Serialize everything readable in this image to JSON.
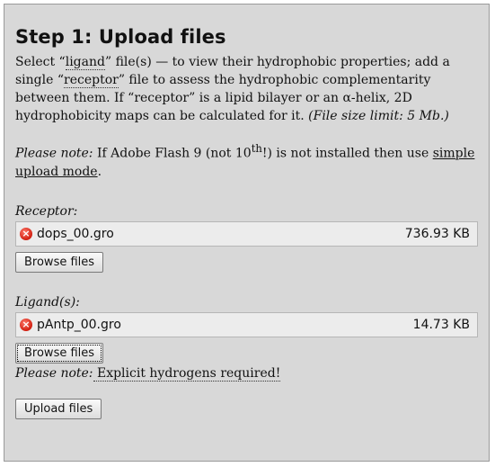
{
  "title": "Step 1: Upload files",
  "intro": {
    "t1": "Select “",
    "ligand_word": "ligand",
    "t2": "” file(s) — to view their hydrophobic properties; add a single “",
    "receptor_word": "receptor",
    "t3": "” file to assess the hydrophobic complementarity between them. If “receptor” is a lipid bilayer or an α-helix, 2D hydrophobicity maps can be calculated for it. ",
    "size_limit": "(File size limit: 5 Mb.)"
  },
  "flash_note": {
    "label": "Please note:",
    "t1": " If Adobe Flash 9 (not 10",
    "sup": "th",
    "t2": "!) is not installed then use ",
    "link": "simple upload mode",
    "t3": "."
  },
  "receptor": {
    "label": "Receptor:",
    "file_name": "dops_00.gro",
    "file_size": "736.93 KB",
    "browse_label": "Browse files"
  },
  "ligands": {
    "label": "Ligand(s):",
    "file_name": "pAntp_00.gro",
    "file_size": "14.73 KB",
    "browse_label": "Browse files"
  },
  "hydrogen_note": {
    "label": "Please note:",
    "text": " Explicit hydrogens required!"
  },
  "upload_label": "Upload files",
  "icons": {
    "remove": "remove-file-icon"
  },
  "colors": {
    "panel_bg": "#d8d8d8",
    "remove_icon": "#d11e10"
  }
}
